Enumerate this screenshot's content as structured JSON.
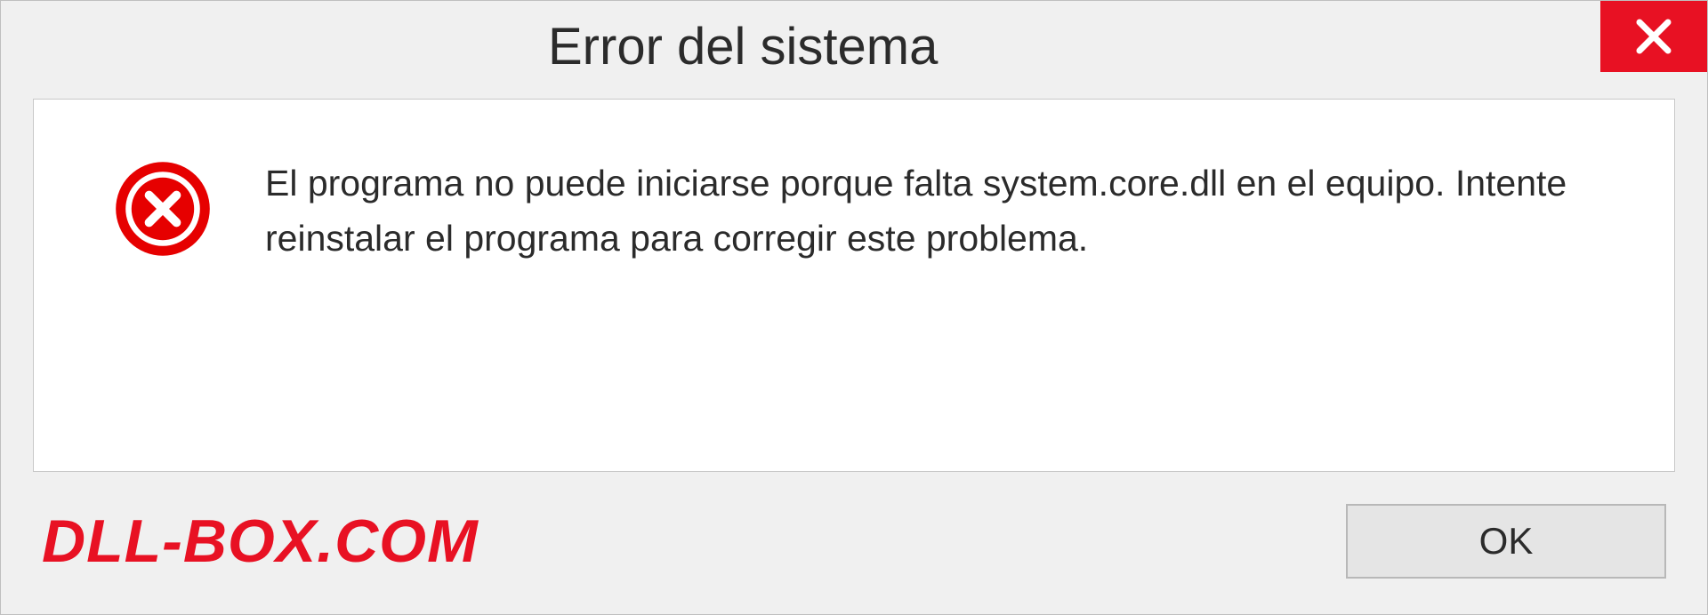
{
  "dialog": {
    "title": "Error del sistema",
    "message": "El programa no puede iniciarse porque falta system.core.dll en el equipo. Intente reinstalar el programa para corregir este problema.",
    "ok_label": "OK"
  },
  "watermark": "DLL-BOX.COM",
  "colors": {
    "error_red": "#e81123",
    "bg_gray": "#f0f0f0"
  }
}
